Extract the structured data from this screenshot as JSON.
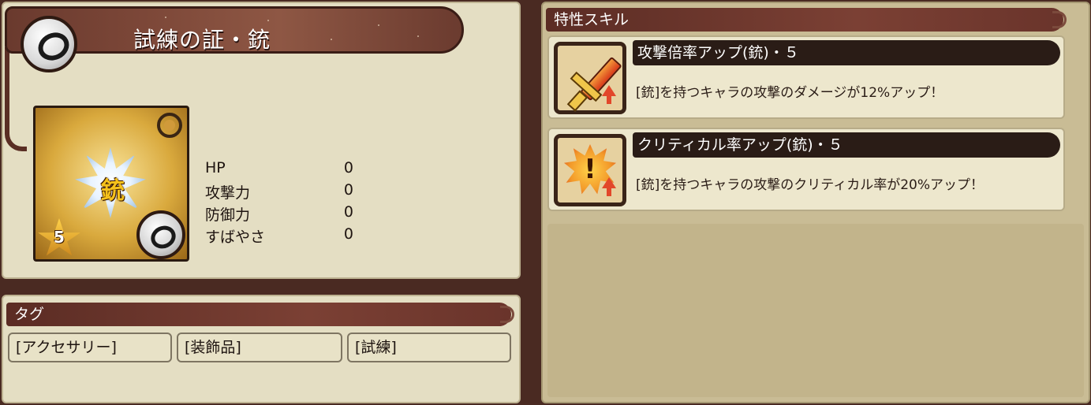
{
  "item": {
    "name": "試練の証・銃",
    "card_kanji": "銃",
    "rarity": "5",
    "stats": [
      {
        "label": "HP",
        "value": "0"
      },
      {
        "label": "攻撃力",
        "value": "0"
      },
      {
        "label": "防御力",
        "value": "0"
      },
      {
        "label": "すばやさ",
        "value": "0"
      }
    ]
  },
  "tags": {
    "header": "タグ",
    "items": [
      "[アクセサリー]",
      "[装飾品]",
      "[試練]"
    ]
  },
  "skills": {
    "header": "特性スキル",
    "items": [
      {
        "name": "攻撃倍率アップ(銃)・５",
        "description": "[銃]を持つキャラの攻撃のダメージが12%アップ！",
        "icon": "sword-up-icon"
      },
      {
        "name": "クリティカル率アップ(銃)・５",
        "description": "[銃]を持つキャラの攻撃のクリティカル率が20%アップ！",
        "icon": "critical-up-icon"
      }
    ]
  },
  "colors": {
    "panel_bg": "#e4dec3",
    "header_bg": "#6a342b",
    "frame_bg": "#4a2a22",
    "skill_name_bg": "#2a1c16"
  }
}
